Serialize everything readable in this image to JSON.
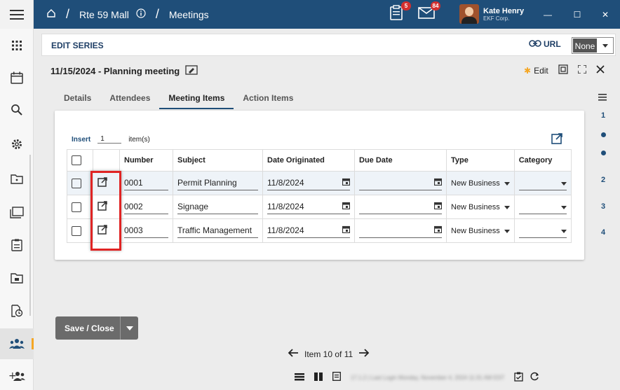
{
  "topbar": {
    "crumbs": [
      "Rte 59 Mall",
      "Meetings"
    ],
    "notifications": [
      {
        "icon": "clipboard-icon",
        "count": "5"
      },
      {
        "icon": "mail-icon",
        "count": "84"
      }
    ],
    "user": {
      "name": "Kate Henry",
      "company": "EKF Corp."
    }
  },
  "editbar": {
    "title": "EDIT SERIES",
    "url_label": "URL",
    "select_value": "None"
  },
  "meeting": {
    "title": "11/15/2024 - Planning meeting",
    "edit_label": "Edit"
  },
  "tabs": [
    {
      "label": "Details",
      "active": false
    },
    {
      "label": "Attendees",
      "active": false
    },
    {
      "label": "Meeting Items",
      "active": true
    },
    {
      "label": "Action Items",
      "active": false
    }
  ],
  "grid": {
    "insert_label": "Insert",
    "insert_count": "1",
    "insert_unit": "item(s)",
    "columns": [
      "Number",
      "Subject",
      "Date Originated",
      "Due Date",
      "Type",
      "Category"
    ],
    "rows": [
      {
        "number": "0001",
        "subject": "Permit Planning",
        "date_originated": "11/8/2024",
        "due_date": "",
        "type": "New Business",
        "category": ""
      },
      {
        "number": "0002",
        "subject": "Signage",
        "date_originated": "11/8/2024",
        "due_date": "",
        "type": "New Business",
        "category": ""
      },
      {
        "number": "0003",
        "subject": "Traffic Management",
        "date_originated": "11/8/2024",
        "due_date": "",
        "type": "New Business",
        "category": ""
      }
    ]
  },
  "steps": [
    "1",
    "2",
    "3",
    "4"
  ],
  "footer": {
    "save_label": "Save / Close",
    "pager_text": "Item 10 of 11",
    "status_text": "17.1.2 | Last Login Monday, November 4, 2024 11:31 AM EST"
  },
  "colors": {
    "primary": "#1f4e79",
    "highlight": "#e02424",
    "accent": "#f5a623"
  }
}
